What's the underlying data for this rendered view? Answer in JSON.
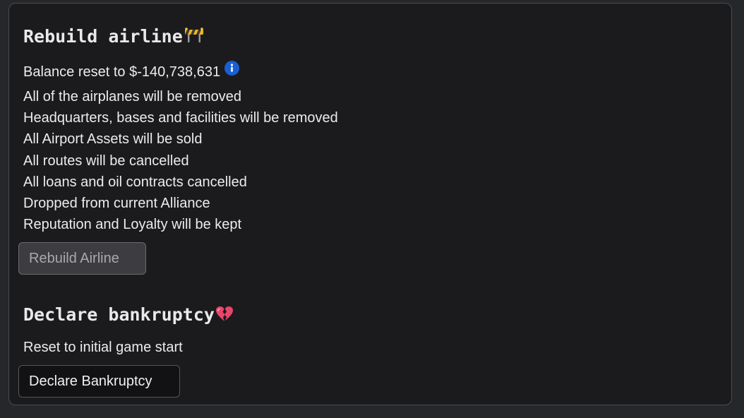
{
  "rebuild": {
    "title": "Rebuild airline",
    "title_icon": "construction-barrier-icon",
    "balance_text": "Balance reset to $-140,738,631",
    "info_icon": "info-icon",
    "consequences": [
      "All of the airplanes will be removed",
      "Headquarters, bases and facilities will be removed",
      "All Airport Assets will be sold",
      "All routes will be cancelled",
      "All loans and oil contracts cancelled",
      "Dropped from current Alliance",
      "Reputation and Loyalty will be kept"
    ],
    "button_label": "Rebuild Airline",
    "button_state": "disabled"
  },
  "bankruptcy": {
    "title": "Declare bankruptcy",
    "title_icon": "broken-heart-icon",
    "description": "Reset to initial game start",
    "button_label": "Declare Bankruptcy"
  },
  "colors": {
    "page_background": "#26272b",
    "panel_background": "#1b1b1e",
    "panel_border": "#4a4b50",
    "info_icon": "#1a5fd0",
    "broken_heart": "#e8456b"
  }
}
